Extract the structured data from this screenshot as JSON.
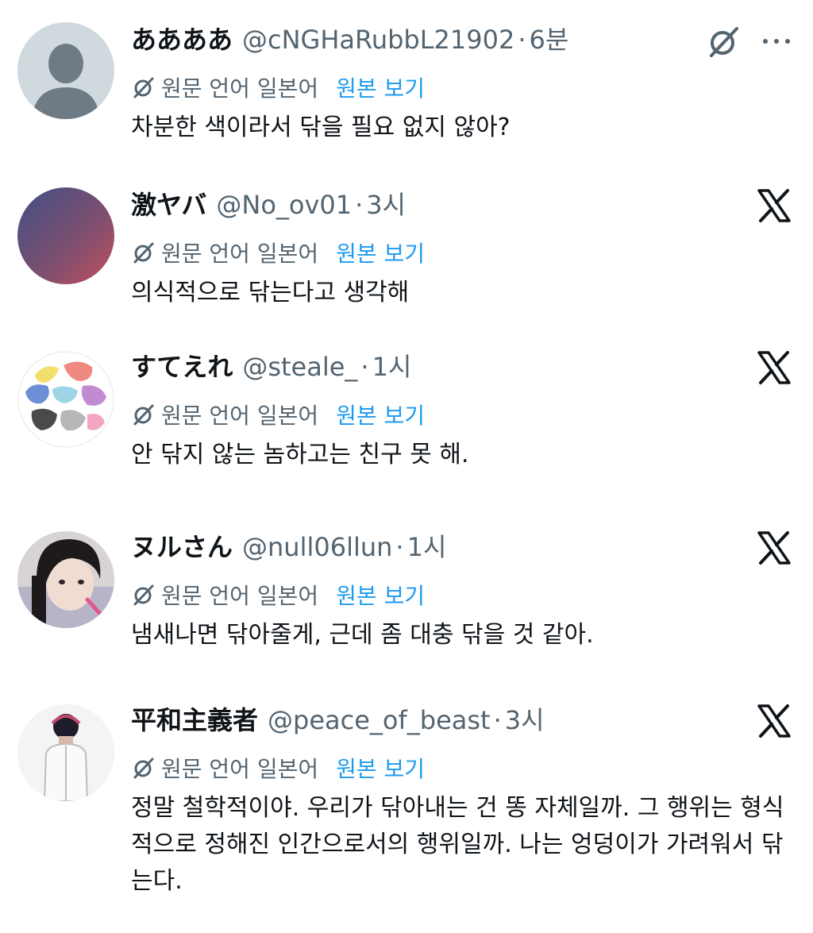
{
  "replies": [
    {
      "display_name": "ああああ",
      "handle": "@cNGHaRubbL21902",
      "time": "6분",
      "translation_label": "원문 언어 일본어",
      "show_original": "원본 보기",
      "text": "차분한 색이라서 닦을 필요 없지 않아?",
      "avatar": "default-person-avatar",
      "trailing_icons": [
        "grok-icon",
        "more-icon"
      ]
    },
    {
      "display_name": "激ヤバ",
      "handle": "@No_ov01",
      "time": "3시",
      "translation_label": "원문 언어 일본어",
      "show_original": "원본 보기",
      "text": "의식적으로 닦는다고 생각해",
      "avatar": "gradient-avatar",
      "trailing_icons": [
        "x-logo-icon"
      ]
    },
    {
      "display_name": "すてえれ",
      "handle": "@steale_",
      "time": "1시",
      "translation_label": "원문 언어 일본어",
      "show_original": "원본 보기",
      "text": "안 닦지 않는 놈하고는 친구 못 해.",
      "avatar": "colorful-blob-avatar",
      "trailing_icons": [
        "x-logo-icon"
      ]
    },
    {
      "display_name": "ヌルさん",
      "handle": "@null06llun",
      "time": "1시",
      "translation_label": "원문 언어 일본어",
      "show_original": "원본 보기",
      "text": "냄새나면 닦아줄게, 근데 좀 대충 닦을 것 같아.",
      "avatar": "photo-avatar",
      "trailing_icons": [
        "x-logo-icon"
      ]
    },
    {
      "display_name": "平和主義者",
      "handle": "@peace_of_beast",
      "time": "3시",
      "translation_label": "원문 언어 일본어",
      "show_original": "원본 보기",
      "text": "정말 철학적이야. 우리가 닦아내는 건 똥 자체일까. 그 행위는 형식적으로 정해진 인간으로서의 행위일까. 나는 엉덩이가 가려워서 닦는다.",
      "avatar": "person-photo-avatar",
      "trailing_icons": [
        "x-logo-icon"
      ]
    }
  ],
  "colors": {
    "text_primary": "#0f1419",
    "text_secondary": "#536471",
    "link": "#1d9bf0"
  },
  "separator": "·"
}
